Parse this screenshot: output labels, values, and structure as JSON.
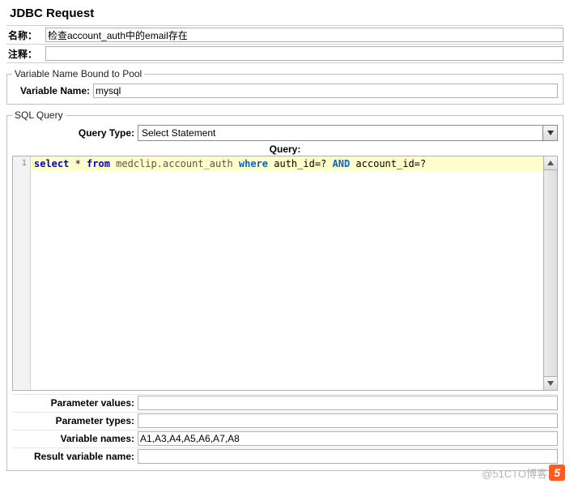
{
  "title": "JDBC Request",
  "header": {
    "name_label": "名称：",
    "name_value": "检查account_auth中的email存在",
    "comment_label": "注释：",
    "comment_value": ""
  },
  "pool": {
    "legend": "Variable Name Bound to Pool",
    "var_label": "Variable Name:",
    "var_value": "mysql"
  },
  "sql": {
    "legend": "SQL Query",
    "type_label": "Query Type:",
    "type_value": "Select Statement",
    "query_label": "Query:",
    "line_no": "1",
    "query_tokens": [
      {
        "t": "select",
        "c": "kw"
      },
      {
        "t": " * ",
        "c": ""
      },
      {
        "t": "from",
        "c": "kw"
      },
      {
        "t": " medclip.account_auth ",
        "c": "ident"
      },
      {
        "t": "where",
        "c": "kw2"
      },
      {
        "t": " auth_id=? ",
        "c": ""
      },
      {
        "t": "AND",
        "c": "kw2"
      },
      {
        "t": " account_id=?",
        "c": ""
      }
    ],
    "param_values_label": "Parameter values:",
    "param_values": "",
    "param_types_label": "Parameter types:",
    "param_types": "",
    "var_names_label": "Variable names:",
    "var_names": "A1,A3,A4,A5,A6,A7,A8",
    "result_var_label": "Result variable name:",
    "result_var": ""
  },
  "watermark": {
    "text": "@51CTO博客",
    "badge": "5"
  }
}
